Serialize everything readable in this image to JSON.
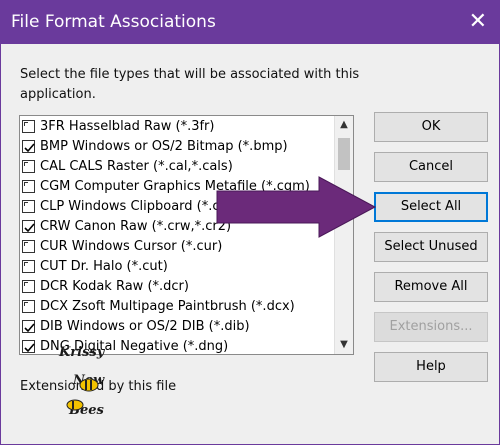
{
  "window": {
    "title": "File Format Associations",
    "close_glyph": "✕"
  },
  "instruction": "Select the file types that will be associated with this application.",
  "file_types": [
    {
      "label": "3FR Hasselblad Raw (*.3fr)",
      "checked": false
    },
    {
      "label": "BMP Windows or OS/2 Bitmap (*.bmp)",
      "checked": true
    },
    {
      "label": "CAL CALS Raster (*.cal,*.cals)",
      "checked": false
    },
    {
      "label": "CGM Computer Graphics Metafile (*.cgm)",
      "checked": false
    },
    {
      "label": "CLP Windows Clipboard (*.c",
      "checked": false
    },
    {
      "label": "CRW Canon Raw (*.crw,*.cr2)",
      "checked": true
    },
    {
      "label": "CUR Windows Cursor (*.cur)",
      "checked": false
    },
    {
      "label": "CUT Dr. Halo (*.cut)",
      "checked": false
    },
    {
      "label": "DCR Kodak Raw (*.dcr)",
      "checked": false
    },
    {
      "label": "DCX Zsoft Multipage Paintbrush (*.dcx)",
      "checked": false
    },
    {
      "label": "DIB Windows or OS/2 DIB (*.dib)",
      "checked": true
    },
    {
      "label": "DNG Digital Negative (*.dng)",
      "checked": true
    }
  ],
  "scrollbar": {
    "up": "▲",
    "down": "▼"
  },
  "buttons": {
    "ok": "OK",
    "cancel": "Cancel",
    "select_all": "Select All",
    "select_unused": "Select Unused",
    "remove_all": "Remove All",
    "extensions": "Extensions...",
    "help": "Help"
  },
  "extensions_label": "Extension  ed by this file",
  "watermark": {
    "line1": "Krissy",
    "line2": "New",
    "line3": "Bees"
  },
  "colors": {
    "accent": "#6a3a9c",
    "arrow": "#6b2a7a",
    "default_border": "#0078d7"
  }
}
